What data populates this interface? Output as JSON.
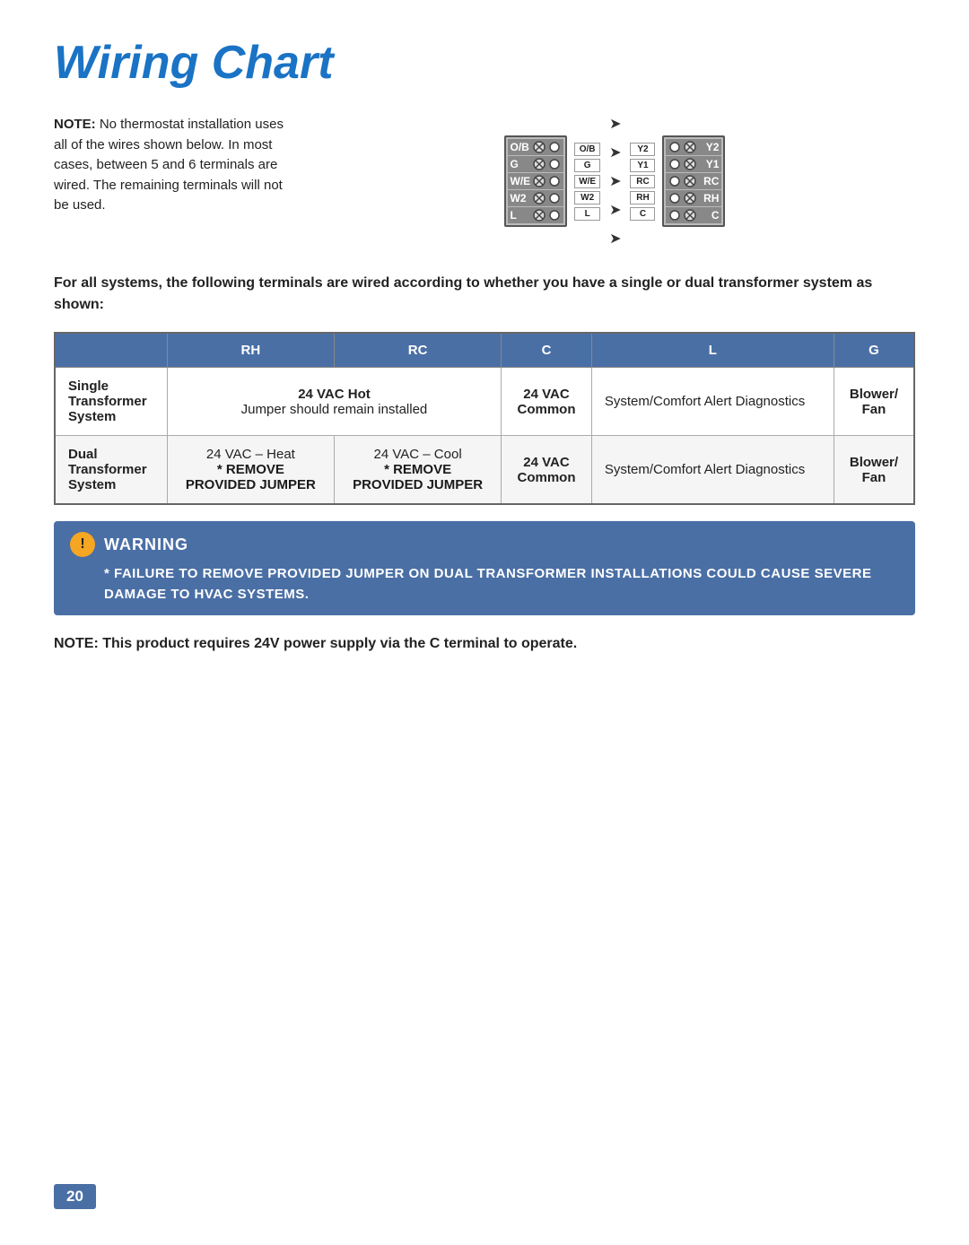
{
  "page": {
    "title": "Wiring Chart",
    "page_number": "20"
  },
  "intro": {
    "note_label": "NOTE:",
    "note_text": " No thermostat installation uses all of the wires shown below. In most cases, between 5 and 6 terminals are wired. The remaining terminals will not be used."
  },
  "description": {
    "text": "For all systems, the following terminals are wired according to whether you have a single or dual transformer system as shown:"
  },
  "table": {
    "headers": [
      "",
      "RH",
      "RC",
      "C",
      "L",
      "G"
    ],
    "rows": [
      {
        "label": "Single Transformer System",
        "rh": "24 VAC Hot",
        "rh_sub": "Jumper should remain installed",
        "rh_colspan": true,
        "rc": "",
        "c": "24 VAC Common",
        "l": "System/Comfort Alert Diagnostics",
        "g": "Blower/ Fan"
      },
      {
        "label": "Dual Transformer System",
        "rh": "24 VAC – Heat",
        "rh_sub": "* REMOVE PROVIDED JUMPER",
        "rc": "24 VAC – Cool",
        "rc_sub": "* REMOVE PROVIDED JUMPER",
        "rh_colspan": false,
        "c": "24 VAC Common",
        "l": "System/Comfort Alert Diagnostics",
        "g": "Blower/ Fan"
      }
    ]
  },
  "warning": {
    "icon": "!",
    "title": "WARNING",
    "text": "* FAILURE TO REMOVE PROVIDED JUMPER ON DUAL TRANSFORMER INSTALLATIONS COULD CAUSE SEVERE DAMAGE TO HVAC SYSTEMS."
  },
  "bottom_note": {
    "text": "NOTE: This product requires 24V power supply via the C terminal to operate."
  },
  "diagram": {
    "left_labels": [
      "O/B",
      "G",
      "W/E",
      "W2",
      "L"
    ],
    "center_labels": [
      "O/B",
      "G",
      "W/E",
      "W2",
      "L"
    ],
    "right_labels_mid": [
      "Y2",
      "Y1",
      "RC",
      "RH",
      "C"
    ],
    "right_labels_far": [
      "Y2",
      "Y1",
      "RC",
      "RH",
      "C"
    ]
  }
}
